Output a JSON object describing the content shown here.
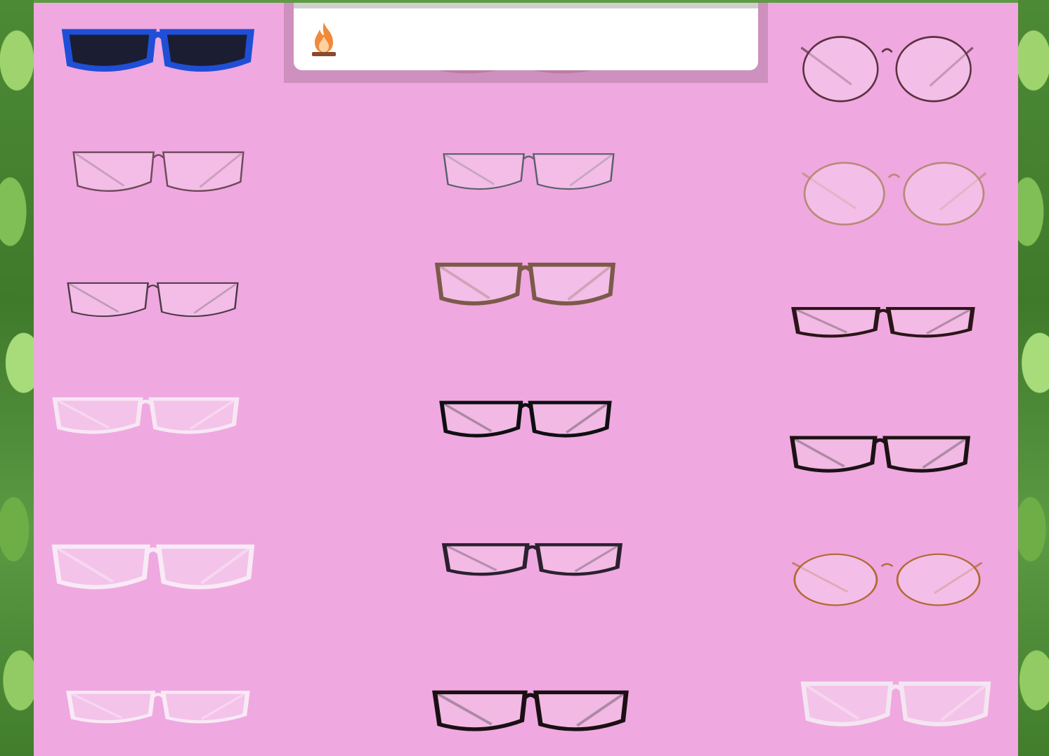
{
  "popup": {
    "icon": "fire-icon",
    "text": ""
  },
  "colors": {
    "board": "#f0a8e0",
    "leaves": "#5f9a44",
    "popup_bg": "#ffffff",
    "flame": "#f08a3a"
  },
  "glasses": [
    {
      "style": "sunglasses",
      "frame": "#1f4fd6",
      "lens": "#1b1d33"
    },
    {
      "style": "reading",
      "frame": "#7a2a3a",
      "lens": "#f3c6ea"
    },
    {
      "style": "round",
      "frame": "#5a3240",
      "lens": "#f6cfee"
    },
    {
      "style": "metal",
      "frame": "#6e4a5a",
      "lens": "#f5cdec"
    },
    {
      "style": "metal",
      "frame": "#5a5f6a",
      "lens": "#f5cdec"
    },
    {
      "style": "round",
      "frame": "#b88a7a",
      "lens": "#f6d2ef"
    },
    {
      "style": "metal",
      "frame": "#4c3a45",
      "lens": "#f5cdec"
    },
    {
      "style": "cat-eye",
      "frame": "#7c5a4a",
      "lens": "#f6d0ee"
    },
    {
      "style": "rect",
      "frame": "#2a1618",
      "lens": "#f4c8e8"
    },
    {
      "style": "clear",
      "frame": "#f7e7f4",
      "lens": "#f7d8f0"
    },
    {
      "style": "rect",
      "frame": "#0f0f12",
      "lens": "#f3c6e8"
    },
    {
      "style": "rect",
      "frame": "#1c1214",
      "lens": "#f3c6e8"
    },
    {
      "style": "clear",
      "frame": "#f8eaf6",
      "lens": "#f7d8f0"
    },
    {
      "style": "rect",
      "frame": "#2b2030",
      "lens": "#f4c8e9"
    },
    {
      "style": "round",
      "frame": "#b06a35",
      "lens": "#f6d0ee"
    },
    {
      "style": "clear",
      "frame": "#f8eaf6",
      "lens": "#f7d8f0"
    },
    {
      "style": "rect",
      "frame": "#1a1014",
      "lens": "#f3c6e8"
    },
    {
      "style": "clear",
      "frame": "#f3e6f1",
      "lens": "#f7d8f0"
    }
  ]
}
